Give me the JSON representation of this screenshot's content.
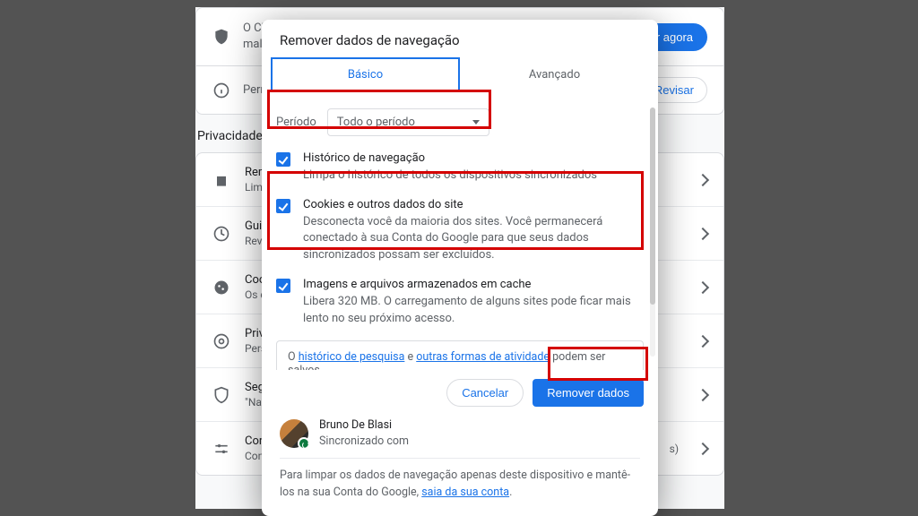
{
  "background": {
    "top_banner": "O Chrome pode ajudar na proteção contra violações de dados, extensões mali",
    "verify_button": "ar agora",
    "perm_label": "Perm",
    "review_button": "Revisar",
    "section_title": "Privacidade e",
    "items": [
      {
        "title": "Remo",
        "caption": "Limp"
      },
      {
        "title": "Guia",
        "caption": "Revis"
      },
      {
        "title": "Cook",
        "caption": "Os c"
      },
      {
        "title": "Priva",
        "caption": "Pers"
      },
      {
        "title": "Segu",
        "caption": "\"Nav"
      },
      {
        "title": "Conf",
        "caption": "Cont"
      }
    ],
    "trailing_s": "s)"
  },
  "modal": {
    "title": "Remover dados de navegação",
    "tabs": {
      "basic": "Básico",
      "advanced": "Avançado"
    },
    "period_label": "Período",
    "period_value": "Todo o período",
    "options": [
      {
        "title": "Histórico de navegação",
        "desc": "Limpa o histórico de todos os dispositivos sincronizados"
      },
      {
        "title": "Cookies e outros dados do site",
        "desc": "Desconecta você da maioria dos sites. Você permanecerá conectado à sua Conta do Google para que seus dados sincronizados possam ser excluídos."
      },
      {
        "title": "Imagens e arquivos armazenados em cache",
        "desc": "Libera 320 MB. O carregamento de alguns sites pode ficar mais lento no seu próximo acesso."
      }
    ],
    "footer_pre": "O ",
    "footer_link1": "histórico de pesquisa",
    "footer_mid": " e ",
    "footer_link2": "outras formas de atividade",
    "footer_post": " podem ser salvos",
    "cancel": "Cancelar",
    "clear": "Remover dados",
    "profile": {
      "name": "Bruno De Blasi",
      "sync": "Sincronizado com"
    },
    "note_pre": "Para limpar os dados de navegação apenas deste dispositivo e mantê-los na sua Conta do Google, ",
    "note_link": "saia da sua conta",
    "note_post": "."
  }
}
